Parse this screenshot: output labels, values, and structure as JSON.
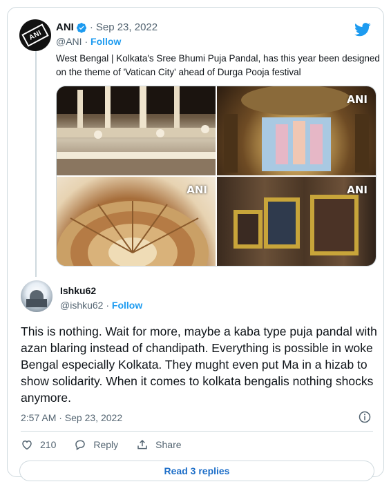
{
  "tweet": {
    "author": "ANI",
    "handle": "@ANI",
    "date": "Sep 23, 2022",
    "follow_label": "Follow",
    "text": "West Bengal | Kolkata's Sree Bhumi Puja Pandal, has this year been designed on the theme of 'Vatican City' ahead of Durga Pooja festival",
    "watermark": "ANI"
  },
  "reply": {
    "author": "Ishku62",
    "handle": "@ishku62",
    "follow_label": "Follow",
    "text": "This is nothing. Wait for more, maybe a kaba type puja pandal with azan blaring instead of chandipath. Everything is possible in woke Bengal especially Kolkata. They mught even put Ma in a hizab to show solidarity. When it comes to kolkata bengalis nothing shocks anymore.",
    "timestamp": "2:57 AM · Sep 23, 2022",
    "likes": "210",
    "reply_label": "Reply",
    "share_label": "Share",
    "read_replies": "Read 3 replies"
  },
  "colors": {
    "accent": "#1d9bf0",
    "text_secondary": "#536471",
    "border": "#cfd9de"
  },
  "icons": [
    "twitter-bird-icon",
    "verified-badge-icon",
    "info-icon",
    "heart-icon",
    "reply-icon",
    "share-icon"
  ]
}
